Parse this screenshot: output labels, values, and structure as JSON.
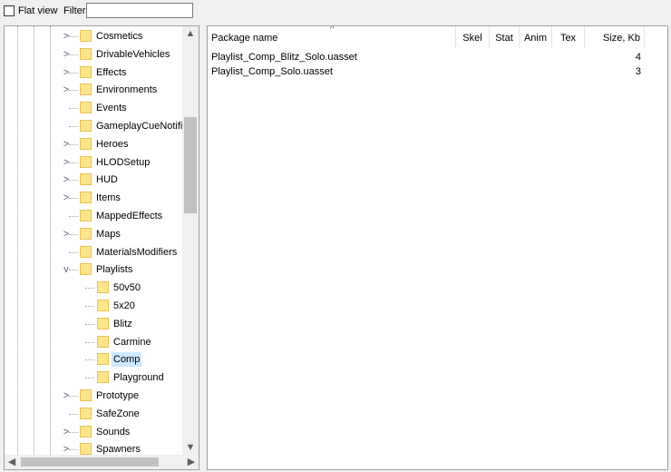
{
  "toolbar": {
    "flat_view_label": "Flat view",
    "filter_label": "Filter:",
    "filter_value": ""
  },
  "tree": {
    "items": [
      {
        "label": "Cosmetics",
        "expander": ">",
        "level": 0
      },
      {
        "label": "DrivableVehicles",
        "expander": ">",
        "level": 0
      },
      {
        "label": "Effects",
        "expander": ">",
        "level": 0
      },
      {
        "label": "Environments",
        "expander": ">",
        "level": 0
      },
      {
        "label": "Events",
        "expander": "",
        "level": 0
      },
      {
        "label": "GameplayCueNotifies",
        "expander": "",
        "level": 0
      },
      {
        "label": "Heroes",
        "expander": ">",
        "level": 0
      },
      {
        "label": "HLODSetup",
        "expander": ">",
        "level": 0
      },
      {
        "label": "HUD",
        "expander": ">",
        "level": 0
      },
      {
        "label": "Items",
        "expander": ">",
        "level": 0
      },
      {
        "label": "MappedEffects",
        "expander": "",
        "level": 0
      },
      {
        "label": "Maps",
        "expander": ">",
        "level": 0
      },
      {
        "label": "MaterialsModifiers",
        "expander": "",
        "level": 0
      },
      {
        "label": "Playlists",
        "expander": "v",
        "level": 0
      },
      {
        "label": "50v50",
        "expander": "",
        "level": 1
      },
      {
        "label": "5x20",
        "expander": "",
        "level": 1
      },
      {
        "label": "Blitz",
        "expander": "",
        "level": 1
      },
      {
        "label": "Carmine",
        "expander": "",
        "level": 1
      },
      {
        "label": "Comp",
        "expander": "",
        "level": 1,
        "selected": true
      },
      {
        "label": "Playground",
        "expander": "",
        "level": 1
      },
      {
        "label": "Prototype",
        "expander": ">",
        "level": 0
      },
      {
        "label": "SafeZone",
        "expander": "",
        "level": 0
      },
      {
        "label": "Sounds",
        "expander": ">",
        "level": 0
      },
      {
        "label": "Spawners",
        "expander": ">",
        "level": 0
      }
    ]
  },
  "list": {
    "columns": [
      {
        "label": "Package name",
        "align": "left"
      },
      {
        "label": "Skel",
        "align": "center"
      },
      {
        "label": "Stat",
        "align": "center"
      },
      {
        "label": "Anim",
        "align": "center"
      },
      {
        "label": "Tex",
        "align": "center"
      },
      {
        "label": "Size, Kb",
        "align": "right"
      }
    ],
    "sort_indicator": "^",
    "rows": [
      {
        "name": "Playlist_Comp_Blitz_Solo.uasset",
        "size": "4"
      },
      {
        "name": "Playlist_Comp_Solo.uasset",
        "size": "3"
      }
    ]
  },
  "icons": {
    "scroll_up": "▲",
    "scroll_down": "▼",
    "scroll_left": "◀",
    "scroll_right": "▶"
  }
}
